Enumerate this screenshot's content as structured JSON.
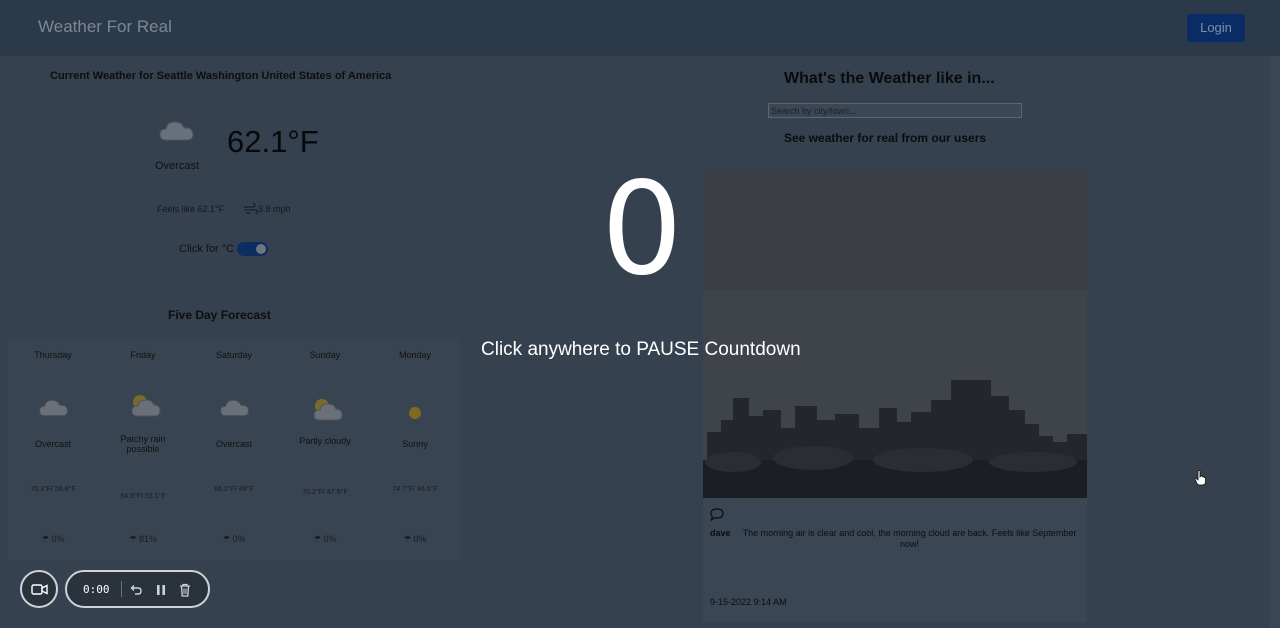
{
  "navbar": {
    "brand": "Weather For Real",
    "login_label": "Login"
  },
  "current": {
    "title": "Current Weather for Seattle Washington United States of America",
    "icon": "cloud-icon",
    "condition": "Overcast",
    "temperature": "62.1°F",
    "feels_like": "Feels like 62.1°F",
    "wind": "3.8 mph",
    "unit_toggle_label": "Click for °C"
  },
  "forecast": {
    "title": "Five Day Forecast",
    "days": [
      {
        "day": "Thursday",
        "icon": "cloud-icon",
        "condition": "Overcast",
        "temps": "70.3°F/ 56.8°F",
        "precip": "0%"
      },
      {
        "day": "Friday",
        "icon": "sun-cloud-rain-icon",
        "condition": "Patchy rain possible",
        "temps": "64.9°F/ 53.1°F",
        "precip": "81%"
      },
      {
        "day": "Saturday",
        "icon": "cloud-icon",
        "condition": "Overcast",
        "temps": "66.2°F/ 49°F",
        "precip": "0%"
      },
      {
        "day": "Sunday",
        "icon": "sun-cloud-icon",
        "condition": "Partly cloudy",
        "temps": "70.2°F/ 47.5°F",
        "precip": "0%"
      },
      {
        "day": "Monday",
        "icon": "sun-icon",
        "condition": "Sunny",
        "temps": "74.7°F/ 46.6°F",
        "precip": "0%"
      }
    ]
  },
  "community": {
    "title": "What's the Weather like in...",
    "search_placeholder": "Search by city/town...",
    "subtitle": "See weather for real from our users",
    "post": {
      "author": "dave",
      "text": "The morning air is clear and cool, the morning cloud are back. Feels like September now!",
      "date": "9-15-2022 9:14 AM"
    }
  },
  "countdown": {
    "number": "0",
    "message": "Click anywhere to PAUSE Countdown"
  },
  "recorder": {
    "time": "0:00"
  },
  "colors": {
    "overlay_bg": "#35414f",
    "navbar_bg": "#2b3a4a",
    "login_bg": "#0a2c66",
    "toggle_bg": "#0c2c62",
    "overlay_text": "#ffffff"
  }
}
